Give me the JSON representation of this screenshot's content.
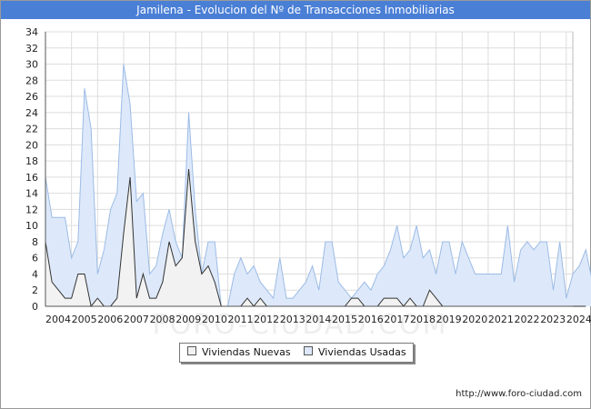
{
  "title": "Jamilena - Evolucion del Nº de Transacciones Inmobiliarias",
  "source": "http://www.foro-ciudad.com",
  "watermark": "FORO-CIUDAD.COM",
  "colors": {
    "title_bg": "#4a7fd6",
    "nuevas_fill": "#f2f2f2",
    "nuevas_line": "#333333",
    "usadas_fill": "#dde9fa",
    "usadas_line": "#9cbbe6"
  },
  "chart_data": {
    "type": "area",
    "x_start": 2004,
    "x_step": 0.25,
    "ylim": [
      0,
      34
    ],
    "yticks": [
      0,
      2,
      4,
      6,
      8,
      10,
      12,
      14,
      16,
      18,
      20,
      22,
      24,
      26,
      28,
      30,
      32,
      34
    ],
    "xticks": [
      "2004",
      "2005",
      "2006",
      "2007",
      "2008",
      "2009",
      "2010",
      "2011",
      "2012",
      "2013",
      "2014",
      "2015",
      "2016",
      "2017",
      "2018",
      "2019",
      "2020",
      "2021",
      "2022",
      "2023",
      "2024"
    ],
    "grid": true,
    "legend_position": "bottom",
    "series": [
      {
        "name": "Viviendas Nuevas",
        "values": [
          8,
          3,
          2,
          1,
          1,
          4,
          4,
          0,
          1,
          0,
          0,
          1,
          9,
          16,
          1,
          4,
          1,
          1,
          3,
          8,
          5,
          6,
          17,
          8,
          4,
          5,
          3,
          0,
          0,
          0,
          0,
          1,
          0,
          1,
          0,
          0,
          0,
          0,
          0,
          0,
          0,
          0,
          0,
          0,
          0,
          0,
          0,
          1,
          1,
          0,
          0,
          0,
          1,
          1,
          1,
          0,
          1,
          0,
          0,
          2,
          1,
          0,
          0,
          0,
          0,
          0,
          0,
          0,
          0,
          0,
          0,
          0,
          0,
          0,
          0,
          0,
          0,
          0,
          0,
          0,
          0,
          0,
          0,
          0
        ]
      },
      {
        "name": "Viviendas Usadas",
        "values": [
          16,
          11,
          11,
          11,
          6,
          8,
          27,
          22,
          4,
          7,
          12,
          14,
          30,
          25,
          13,
          14,
          4,
          5,
          9,
          12,
          8,
          6,
          24,
          12,
          4,
          8,
          8,
          0,
          0,
          4,
          6,
          4,
          5,
          3,
          2,
          1,
          6,
          1,
          1,
          2,
          3,
          5,
          2,
          8,
          8,
          3,
          2,
          1,
          2,
          3,
          2,
          4,
          5,
          7,
          10,
          6,
          7,
          10,
          6,
          7,
          4,
          8,
          8,
          4,
          8,
          6,
          4,
          4,
          4,
          4,
          4,
          10,
          3,
          7,
          8,
          7,
          8,
          8,
          2,
          8,
          1,
          4,
          5,
          7,
          3
        ]
      }
    ]
  },
  "legend": {
    "nuevas_label": "Viviendas Nuevas",
    "usadas_label": "Viviendas Usadas"
  }
}
